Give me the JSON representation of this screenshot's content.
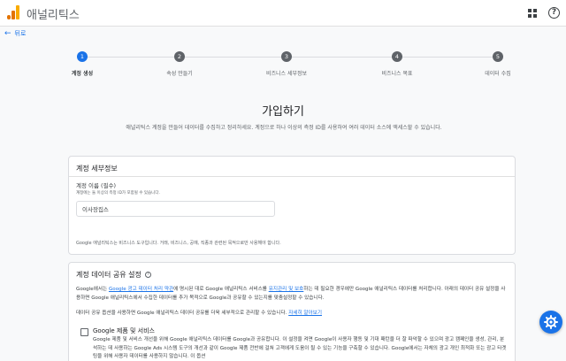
{
  "header": {
    "app_title": "애널리틱스",
    "apps_icon": "apps-grid-icon",
    "help_icon": "help-icon",
    "help_glyph": "?"
  },
  "nav": {
    "back_label": "뒤로",
    "back_glyph": "←"
  },
  "stepper": {
    "steps": [
      {
        "number": "1",
        "label": "계정 생성",
        "active": true
      },
      {
        "number": "2",
        "label": "속성 만들기",
        "active": false
      },
      {
        "number": "3",
        "label": "비즈니스 세부정보",
        "active": false
      },
      {
        "number": "4",
        "label": "비즈니스 목표",
        "active": false
      },
      {
        "number": "5",
        "label": "데이터 수집",
        "active": false
      }
    ]
  },
  "main": {
    "title": "가입하기",
    "intro": "애널리틱스 계정을 만들어 데이터를 수집하고 정리하세요. 계정으로 하나 이상의 측정 ID를 사용하여 여러 데이터 소스에 액세스할 수 있습니다."
  },
  "account_details": {
    "title": "계정 세부정보",
    "name_label": "계정 이름 (필수)",
    "name_help": "계정에는 둘 이상의 측정 ID가 포함될 수 있습니다.",
    "name_value": "이사장집스",
    "note": "Google 애널리틱스는 비즈니스 도구입니다. 거래, 비즈니스, 공예, 직종과 관련된 목적으로만 사용해야 합니다."
  },
  "data_sharing": {
    "title": "계정 데이터 공유 설정",
    "info_glyph": "?",
    "para1_a": "Google에서는 ",
    "para1_link1": "Google 광고 데이터 처리 약관",
    "para1_b": "에 명시된 대로 Google 애널리틱스 서비스를 ",
    "para1_link2": "유지관리 및 보호",
    "para1_c": "하는 데 필요한 경우에만 Google 애널리틱스 데이터를 처리합니다. 아래의 데이터 공유 설정을 사용하면 Google 애널리틱스에서 수집한 데이터를 추가 목적으로 Google과 공유할 수 있는지를 맞춤설정할 수 있습니다.",
    "para2": "데이터 공유 옵션을 사용하면 Google 애널리틱스 데이터 공유를 더욱 세부적으로 관리할 수 있습니다. ",
    "para2_link": "자세히 알아보기",
    "option_label": "Google 제품 및 서비스",
    "option_desc": "Google 제품 및 서비스 개선을 위해 Google 애널리틱스 데이터를 Google과 공유합니다. 이 설정을 켜면 Google이 사용자 행동 및 기대 패턴을 더 잘 파악할 수 있으며 광고 캠페인을 생성, 관리, 분석하는 데 사용하는 Google Ads 시스템 도구의 개선과 같이 Google 제품 전반에 걸쳐 고객에게 도움이 될 수 있는 기능을 구축할 수 있습니다. Google에서는 자체의 광고 개인 최적화 또는 광고 타겟팅을 위해 사용자 데이터를 사용하지 않습니다. 이 옵션"
  },
  "fab": {
    "icon": "settings-gear-icon"
  },
  "colors": {
    "accent": "#1a73e8",
    "logo_orange": "#f9ab00"
  }
}
